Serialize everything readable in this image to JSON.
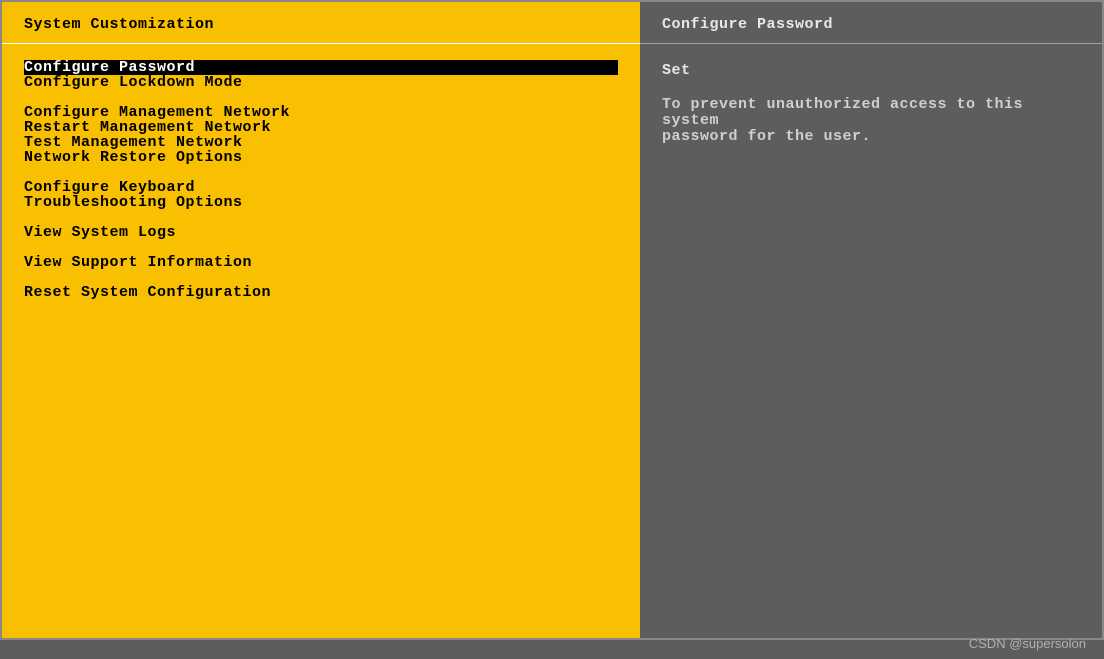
{
  "left": {
    "title": "System Customization",
    "menu": {
      "group1": {
        "item0": "Configure Password",
        "item1": "Configure Lockdown Mode"
      },
      "group2": {
        "item0": "Configure Management Network",
        "item1": "Restart Management Network",
        "item2": "Test Management Network",
        "item3": "Network Restore Options"
      },
      "group3": {
        "item0": "Configure Keyboard",
        "item1": "Troubleshooting Options"
      },
      "group4": {
        "item0": "View System Logs"
      },
      "group5": {
        "item0": "View Support Information"
      },
      "group6": {
        "item0": "Reset System Configuration"
      }
    }
  },
  "right": {
    "title": "Configure Password",
    "action": "Set",
    "description": "To prevent unauthorized access to this system\npassword for the user."
  },
  "watermark": "CSDN @supersolon"
}
